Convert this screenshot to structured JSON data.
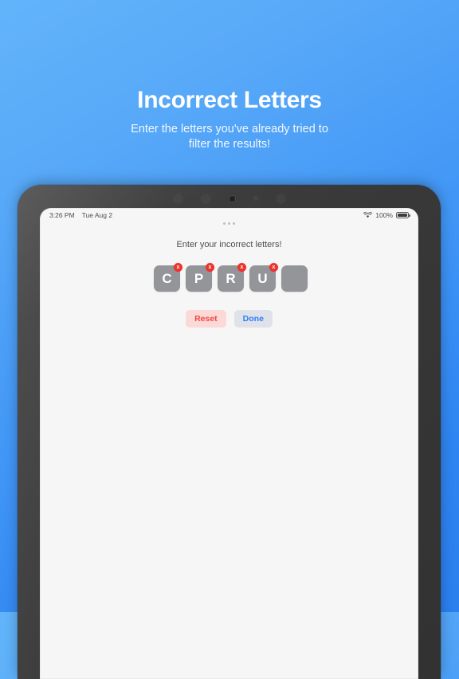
{
  "hero": {
    "title": "Incorrect Letters",
    "subtitle_line1": "Enter the letters you've already tried to",
    "subtitle_line2": "filter the results!"
  },
  "device": {
    "type": "tablet",
    "frame_color": "#373737",
    "screen_bg": "#f6f6f6"
  },
  "status_bar": {
    "time": "3:26 PM",
    "date": "Tue Aug 2",
    "wifi_icon": "wifi-icon",
    "battery_percent": "100%",
    "battery_icon": "battery-full-icon"
  },
  "app": {
    "prompt": "Enter your incorrect letters!",
    "tiles": [
      {
        "letter": "C",
        "has_badge": true,
        "badge_label": "x"
      },
      {
        "letter": "P",
        "has_badge": true,
        "badge_label": "x"
      },
      {
        "letter": "R",
        "has_badge": true,
        "badge_label": "x"
      },
      {
        "letter": "U",
        "has_badge": true,
        "badge_label": "x"
      },
      {
        "letter": "",
        "has_badge": false,
        "badge_label": ""
      }
    ],
    "buttons": {
      "reset_label": "Reset",
      "done_label": "Done"
    }
  },
  "colors": {
    "background_top": "#62b4fa",
    "background_bottom": "#2b7fee",
    "tile_gray": "#939598",
    "badge_red": "#f0322c",
    "reset_bg": "#fbd9d7",
    "reset_text": "#f04a40",
    "done_bg": "#dfe2e8",
    "done_text": "#2f7cf6"
  }
}
